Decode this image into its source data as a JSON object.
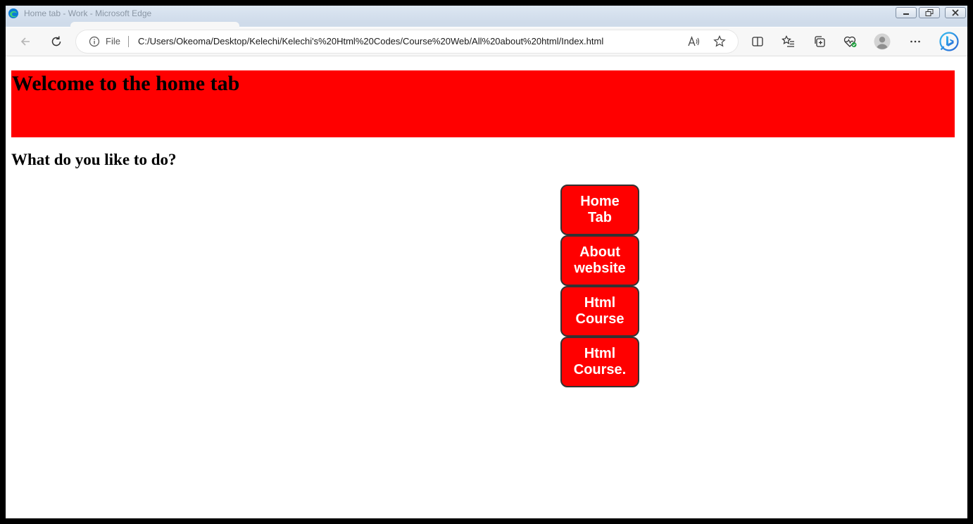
{
  "window": {
    "title": "Home tab - Work - Microsoft Edge"
  },
  "address_bar": {
    "scheme_label": "File",
    "url": "C:/Users/Okeoma/Desktop/Kelechi/Kelechi's%20Html%20Codes/Course%20Web/All%20about%20html/Index.html"
  },
  "icons": {
    "app": "edge-logo-icon",
    "back": "back-arrow-icon",
    "refresh": "refresh-icon",
    "info": "info-icon",
    "read_aloud": "read-aloud-icon",
    "favorite": "star-icon",
    "split_screen": "split-screen-icon",
    "favorites": "favorites-list-icon",
    "collections": "collections-icon",
    "browser_essentials": "heart-pulse-icon",
    "profile": "avatar-icon",
    "more": "ellipsis-icon",
    "bing": "bing-copilot-icon"
  },
  "page": {
    "title": "Welcome to the home tab",
    "question": "What do you like to do?",
    "buttons": [
      {
        "label": "Home Tab"
      },
      {
        "label": "About website"
      },
      {
        "label": "Html Course"
      },
      {
        "label": "Html Course."
      }
    ]
  },
  "colors": {
    "banner": "#ff0000",
    "button_bg": "#ff0000",
    "button_text": "#ffffff",
    "button_border": "#333333"
  }
}
